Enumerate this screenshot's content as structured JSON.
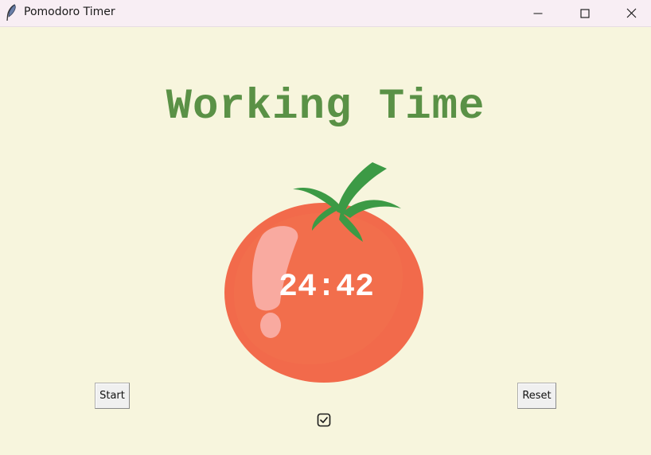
{
  "window": {
    "title": "Pomodoro Timer",
    "controls": {
      "minimize_icon": "minimize-icon",
      "maximize_icon": "maximize-icon",
      "close_icon": "close-icon"
    },
    "app_icon": "feather-icon"
  },
  "main": {
    "heading": "Working Time",
    "timer": "24:42",
    "completed_sessions": "1",
    "image": "tomato-image"
  },
  "buttons": {
    "start_label": "Start",
    "reset_label": "Reset"
  },
  "colors": {
    "background": "#f7f5dd",
    "heading_green": "#5a9146",
    "tomato_red": "#f26a4b",
    "leaf_green": "#3c9a45",
    "timer_text": "#ffffff"
  }
}
